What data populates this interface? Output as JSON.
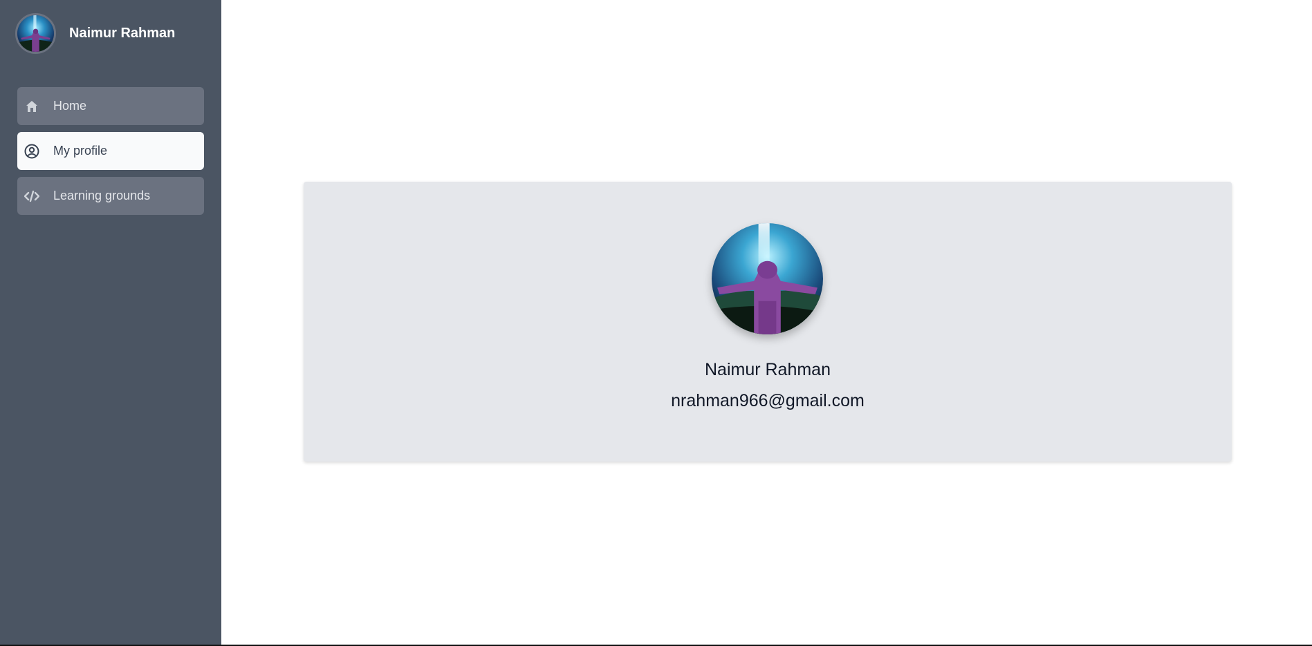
{
  "sidebar": {
    "user_name": "Naimur Rahman",
    "items": [
      {
        "label": "Home",
        "icon": "home-icon",
        "active": false
      },
      {
        "label": "My profile",
        "icon": "user-circle-icon",
        "active": true
      },
      {
        "label": "Learning grounds",
        "icon": "code-icon",
        "active": false
      }
    ]
  },
  "profile": {
    "name": "Naimur Rahman",
    "email": "nrahman966@gmail.com"
  },
  "colors": {
    "sidebar_bg": "#4b5563",
    "nav_item_bg": "#6b7280",
    "nav_active_bg": "#f9fafb",
    "card_bg": "#e5e7eb"
  }
}
